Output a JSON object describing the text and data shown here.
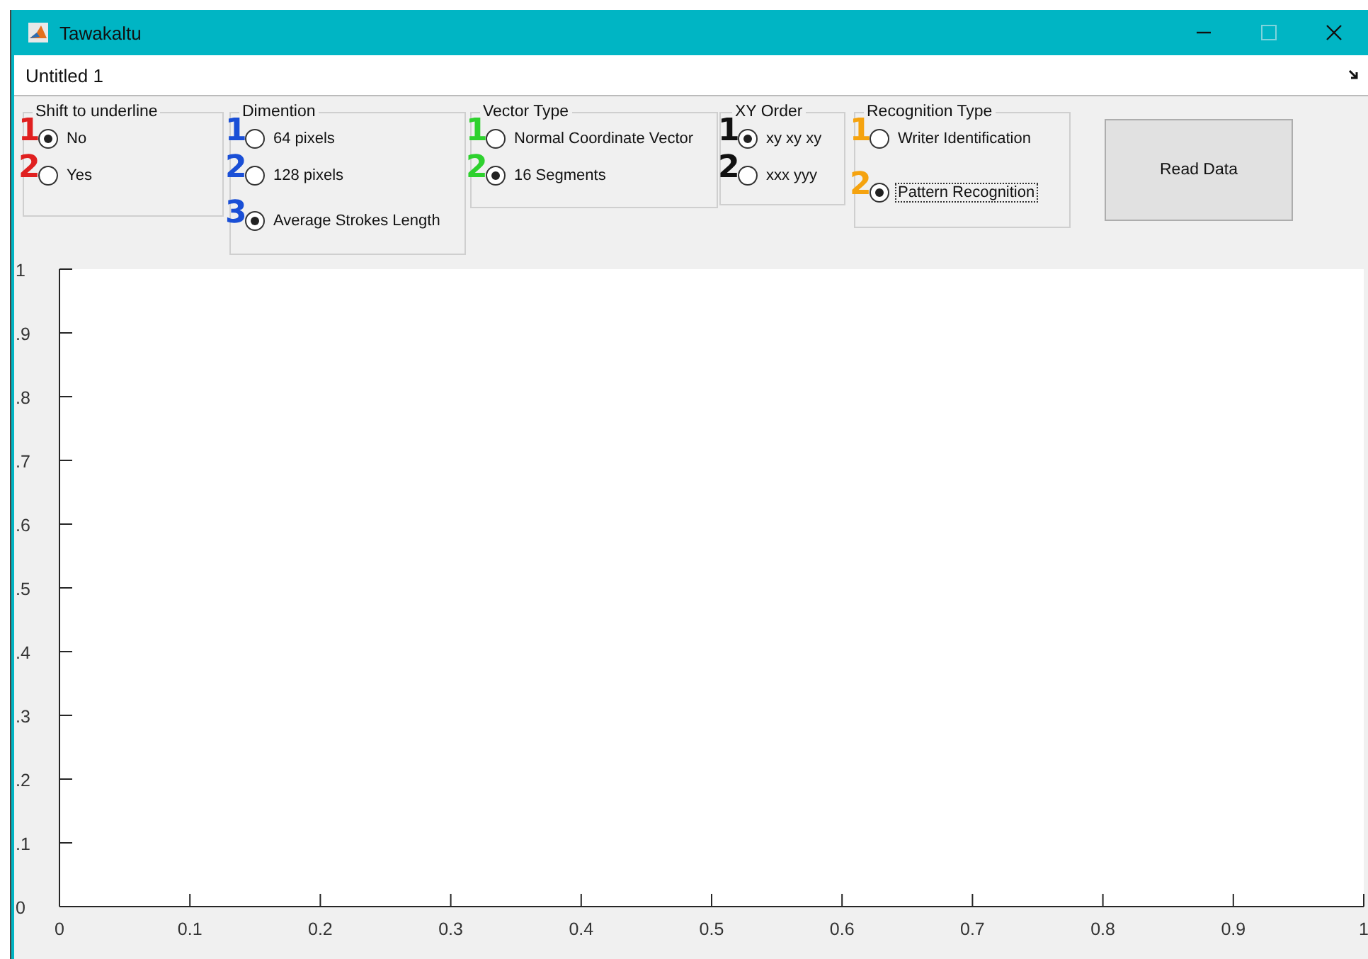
{
  "window": {
    "title": "Tawakaltu"
  },
  "document_tab": {
    "label": "Untitled 1"
  },
  "groups": [
    {
      "title": "Shift to underline",
      "options": [
        {
          "label": "No",
          "selected": true,
          "focused": false,
          "marker": {
            "text": "1",
            "color": "#e02020"
          }
        },
        {
          "label": "Yes",
          "selected": false,
          "focused": false,
          "marker": {
            "text": "2",
            "color": "#e02020"
          }
        }
      ]
    },
    {
      "title": "Dimention",
      "options": [
        {
          "label": "64 pixels",
          "selected": false,
          "focused": false,
          "marker": {
            "text": "1",
            "color": "#1a4fd6"
          }
        },
        {
          "label": "128 pixels",
          "selected": false,
          "focused": false,
          "marker": {
            "text": "2",
            "color": "#1a4fd6"
          }
        },
        {
          "label": "Average Strokes Length",
          "selected": true,
          "focused": false,
          "marker": {
            "text": "3",
            "color": "#1a4fd6"
          }
        }
      ]
    },
    {
      "title": "Vector Type",
      "options": [
        {
          "label": "Normal Coordinate Vector",
          "selected": false,
          "focused": false,
          "marker": {
            "text": "1",
            "color": "#2ed12e"
          }
        },
        {
          "label": "16 Segments",
          "selected": true,
          "focused": false,
          "marker": {
            "text": "2",
            "color": "#2ed12e"
          }
        }
      ]
    },
    {
      "title": "XY Order",
      "options": [
        {
          "label": "xy xy xy",
          "selected": true,
          "focused": false,
          "marker": {
            "text": "1",
            "color": "#111111"
          }
        },
        {
          "label": "xxx yyy",
          "selected": false,
          "focused": false,
          "marker": {
            "text": "2",
            "color": "#111111"
          }
        }
      ]
    },
    {
      "title": "Recognition Type",
      "options": [
        {
          "label": "Writer Identification",
          "selected": false,
          "focused": false,
          "marker": {
            "text": "1",
            "color": "#f5a30f"
          }
        },
        {
          "label": "Pattern Recognition",
          "selected": true,
          "focused": true,
          "marker": {
            "text": "2",
            "color": "#f5a30f"
          }
        }
      ]
    }
  ],
  "read_button": {
    "label": "Read Data"
  },
  "axes": {
    "chart_data": {
      "type": "line",
      "xlim": [
        0,
        1
      ],
      "ylim": [
        0,
        1
      ],
      "xticks": [
        {
          "value": 0,
          "label": "0"
        },
        {
          "value": 0.1,
          "label": "0.1"
        },
        {
          "value": 0.2,
          "label": "0.2"
        },
        {
          "value": 0.3,
          "label": "0.3"
        },
        {
          "value": 0.4,
          "label": "0.4"
        },
        {
          "value": 0.5,
          "label": "0.5"
        },
        {
          "value": 0.6,
          "label": "0.6"
        },
        {
          "value": 0.7,
          "label": "0.7"
        },
        {
          "value": 0.8,
          "label": "0.8"
        },
        {
          "value": 0.9,
          "label": "0.9"
        },
        {
          "value": 1,
          "label": "1"
        }
      ],
      "yticks": [
        {
          "value": 0,
          "label": "0"
        },
        {
          "value": 0.1,
          "label": ".1"
        },
        {
          "value": 0.2,
          "label": ".2"
        },
        {
          "value": 0.3,
          "label": ".3"
        },
        {
          "value": 0.4,
          "label": ".4"
        },
        {
          "value": 0.5,
          "label": ".5"
        },
        {
          "value": 0.6,
          "label": ".6"
        },
        {
          "value": 0.7,
          "label": ".7"
        },
        {
          "value": 0.8,
          "label": ".8"
        },
        {
          "value": 0.9,
          "label": ".9"
        },
        {
          "value": 1,
          "label": "1"
        }
      ]
    }
  }
}
